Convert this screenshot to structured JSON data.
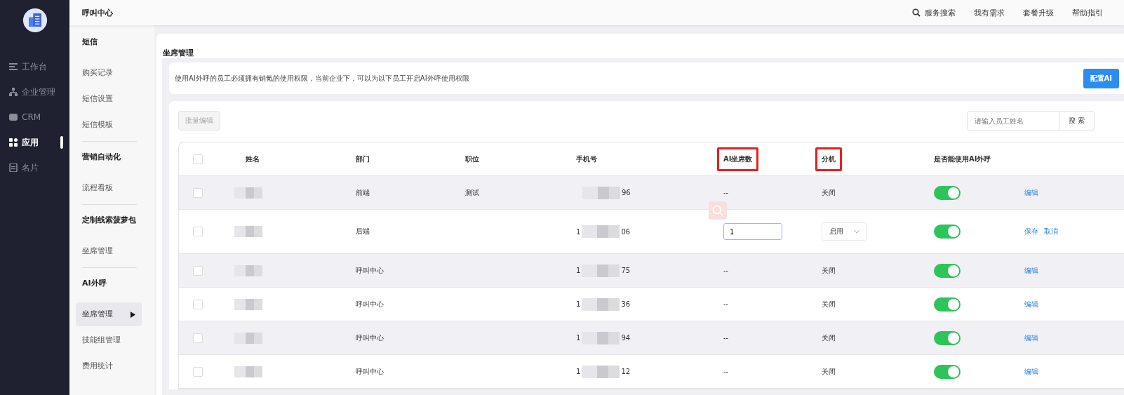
{
  "sidebar": {
    "items": [
      {
        "label": "工作台",
        "selected": false
      },
      {
        "label": "企业管理",
        "selected": false
      },
      {
        "label": "CRM",
        "selected": false
      },
      {
        "label": "应用",
        "selected": true
      },
      {
        "label": "名片",
        "selected": false
      }
    ]
  },
  "topbar": {
    "title": "呼叫中心",
    "links": [
      {
        "kind": "search",
        "label": "服务搜索"
      },
      {
        "kind": "link",
        "label": "我有需求"
      },
      {
        "kind": "link",
        "label": "套餐升级"
      },
      {
        "kind": "link",
        "label": "帮助指引"
      }
    ]
  },
  "subnav": {
    "groups": [
      {
        "title": "短信",
        "items": [
          {
            "label": "购买记录",
            "selected": false
          },
          {
            "label": "短信设置",
            "selected": false
          },
          {
            "label": "短信模板",
            "selected": false
          }
        ]
      },
      {
        "title": "营销自动化",
        "items": [
          {
            "label": "流程看板",
            "selected": false
          }
        ]
      },
      {
        "title": "定制线索菠萝包",
        "items": [
          {
            "label": "坐席管理",
            "selected": false
          }
        ]
      },
      {
        "title": "AI外呼",
        "items": [
          {
            "label": "坐席管理",
            "selected": true
          },
          {
            "label": "技能组管理",
            "selected": false
          },
          {
            "label": "费用统计",
            "selected": false
          }
        ]
      }
    ]
  },
  "page": {
    "title": "坐席管理",
    "notice": "使用AI外呼的员工必须拥有销氪的使用权限，当前企业下，可以为以下员工开启AI外呼使用权限",
    "notice_button": "配置AI",
    "batch_button": {
      "label": "批量编辑",
      "disabled": true
    },
    "search": {
      "placeholder": "请输入员工姓名",
      "button": "搜 索"
    }
  },
  "table": {
    "header_checked": false,
    "columns": [
      {
        "label": "姓名",
        "highlighted": false
      },
      {
        "label": "部门",
        "highlighted": false
      },
      {
        "label": "职位",
        "highlighted": false
      },
      {
        "label": "手机号",
        "highlighted": false
      },
      {
        "label": "AI坐席数",
        "highlighted": true
      },
      {
        "label": "分机",
        "highlighted": true
      },
      {
        "label": "是否能使用AI外呼",
        "highlighted": false
      }
    ],
    "rows": [
      {
        "kind": "view",
        "checked": false,
        "department": "前端",
        "position": "测试",
        "phone_end": "96",
        "seats": "--",
        "extension": "关闭",
        "ai_enabled": true,
        "actions": [
          "编辑"
        ]
      },
      {
        "kind": "edit",
        "checked": false,
        "department": "后端",
        "phone_start": "1",
        "phone_end": "06",
        "seats": "1",
        "extension": "启用",
        "ai_enabled": true,
        "actions": [
          "保存",
          "取消"
        ]
      },
      {
        "kind": "view",
        "checked": false,
        "department": "呼叫中心",
        "phone_start": "1",
        "phone_end": "75",
        "seats": "--",
        "extension": "关闭",
        "ai_enabled": true,
        "actions": [
          "编辑"
        ]
      },
      {
        "kind": "view",
        "checked": false,
        "department": "呼叫中心",
        "phone_start": "1",
        "phone_end": "36",
        "seats": "--",
        "extension": "关闭",
        "ai_enabled": true,
        "actions": [
          "编辑"
        ]
      },
      {
        "kind": "view",
        "checked": false,
        "department": "呼叫中心",
        "phone_start": "1",
        "phone_end": "94",
        "seats": "--",
        "extension": "关闭",
        "ai_enabled": true,
        "actions": [
          "编辑"
        ]
      },
      {
        "kind": "view",
        "checked": false,
        "department": "呼叫中心",
        "phone_start": "1",
        "phone_end": "12",
        "seats": "--",
        "extension": "关闭",
        "ai_enabled": true,
        "actions": [
          "编辑"
        ]
      }
    ]
  }
}
